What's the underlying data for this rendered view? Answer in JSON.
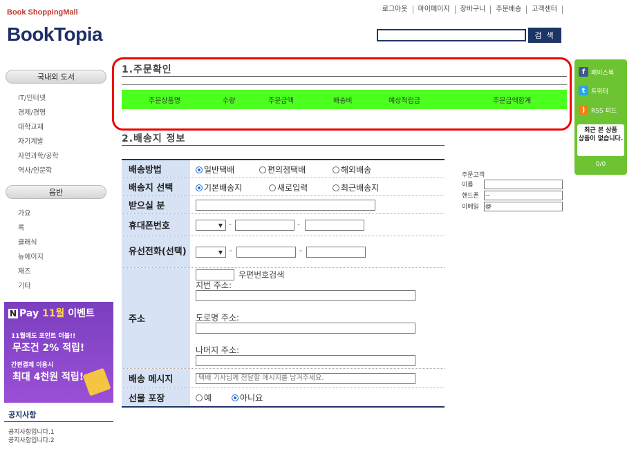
{
  "header": {
    "brand_sub": "Book ShoppingMall",
    "brand": "BookTopia",
    "links": [
      "로그아웃",
      "마이페이지",
      "장바구니",
      "주문배송",
      "고객센터"
    ],
    "search_button": "검 색"
  },
  "sidebar": {
    "cat1": "국내외 도서",
    "cat1_items": [
      "IT/인터넷",
      "경제/경영",
      "대학교재",
      "자기계발",
      "자연과학/공학",
      "역사/인문학"
    ],
    "cat2": "음반",
    "cat2_items": [
      "가요",
      "록",
      "클래식",
      "뉴에이지",
      "재즈",
      "기타"
    ],
    "banner": {
      "npay": "N",
      "pay_word": "Pay",
      "month": "11월",
      "event": "이벤트",
      "line2": "11월에도 포인트 더블!!",
      "line3": "무조건 2% 적립!",
      "line4": "간편결제 이용시",
      "line5": "최대 4천원 적립!"
    },
    "notice_title": "공지사항",
    "notices": [
      "공지사항입니다.1",
      "공지사항입니다.2"
    ]
  },
  "section1": {
    "title": "1.주문확인",
    "columns": [
      "주문상품명",
      "수량",
      "주문금액",
      "배송비",
      "예상적립금",
      "주문금액합계"
    ]
  },
  "section2": {
    "title": "2.배송지 정보",
    "rows": {
      "shipping_method": {
        "label": "배송방법",
        "options": [
          "일반택배",
          "편의점택배",
          "해외배송"
        ],
        "selected": 0
      },
      "address_select": {
        "label": "배송지 선택",
        "options": [
          "기본배송지",
          "새로입력",
          "최근배송지"
        ],
        "selected": 0
      },
      "receiver": {
        "label": "받으실 분"
      },
      "mobile": {
        "label": "휴대폰번호"
      },
      "phone": {
        "label": "유선전화(선택)"
      },
      "address": {
        "label": "주소",
        "postcode_label": "우편번호검색",
        "jibun_label": "지번 주소:",
        "road_label": "도로명 주소:",
        "rest_label": "나머지 주소:"
      },
      "message": {
        "label": "배송 메시지",
        "placeholder": "택배 기사님께 전달할 메시지를 남겨주세요."
      },
      "gift": {
        "label": "선물 포장",
        "options": [
          "예",
          "아니요"
        ],
        "selected": 1
      }
    }
  },
  "customer": {
    "title": "주문고객",
    "name_label": "이름",
    "name_value": "",
    "phone_label": "핸드폰",
    "phone_value": "--",
    "email_label": "이메일",
    "email_value": "@"
  },
  "right_sidebar": {
    "facebook": "페이스북",
    "twitter": "트위터",
    "rss": "RSS 피드",
    "recent_title": "최근 본 상품",
    "recent_empty": "상품이 없습니다.",
    "count": "0/0"
  },
  "colors": {
    "brand": "#1c2f66",
    "accent_red": "#c0392b",
    "table_header_green": "#4cff1f",
    "label_bg": "#d7e3f4",
    "sidebar_green": "#6ec332"
  }
}
